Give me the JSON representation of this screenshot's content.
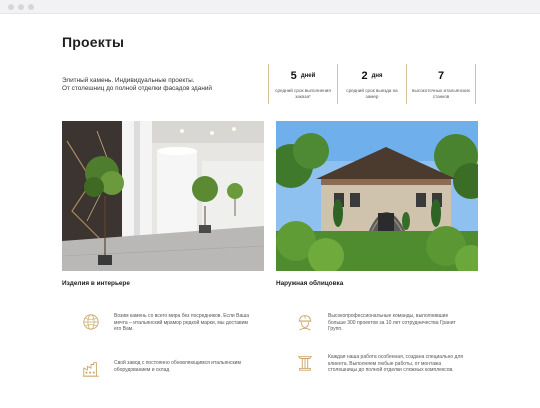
{
  "page": {
    "title": "Проекты",
    "intro_lines": [
      "Элитный камень. Индивидуальные проекты.",
      "От столешниц до полной отделки фасадов зданий"
    ]
  },
  "stats": [
    {
      "value": "5",
      "unit": "дней",
      "label": "средний срок выполнения заказа*"
    },
    {
      "value": "2",
      "unit": "дня",
      "label": "средний срок выезда на замер"
    },
    {
      "value": "7",
      "unit": "",
      "label": "высокоточных итальянских станков"
    }
  ],
  "projects": [
    {
      "caption": "Изделия в интерьере"
    },
    {
      "caption": "Наружная облицовка"
    }
  ],
  "features": [
    {
      "icon": "globe-icon",
      "text": "Возим камень со всего мира без посредников. Если Ваша мечта – итальянский мрамор редкой марки, мы доставим его Вам."
    },
    {
      "icon": "factory-icon",
      "text": "Свой завод с постоянно обновляющимся итальянским оборудованием и склад"
    },
    {
      "icon": "worker-helmet-icon",
      "text": "Высокопрофессиональные команды, выполнившие больше 300 проектов за 10 лет сотрудничества Гранит Групп."
    },
    {
      "icon": "column-icon",
      "text": "Каждая наша работа особенная, создана специально для клиента. Выполняем любые работы, от монтажа столешницы до полной отделки сложных комплексов."
    }
  ],
  "colors": {
    "accent": "#c9a66b",
    "border": "#d6bf93"
  }
}
